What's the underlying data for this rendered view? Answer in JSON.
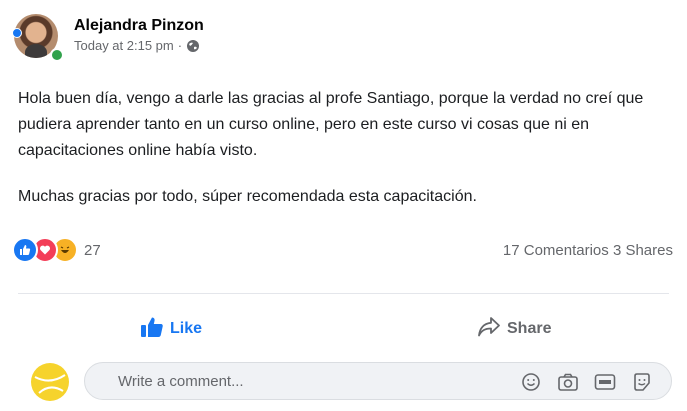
{
  "post": {
    "author": "Alejandra Pinzon",
    "timestamp": "Today at 2:15 pm",
    "separator": "·",
    "privacy_icon": "globe-icon",
    "paragraphs": [
      "Hola buen día, vengo a darle las gracias al profe Santiago, porque la verdad no creí que pudiera aprender tanto en un curso online, pero en este curso vi cosas que ni en capacitaciones online había visto.",
      "Muchas gracias por todo, súper recomendada esta capacitación."
    ]
  },
  "reactions": {
    "icons": [
      "like-reaction-icon",
      "love-reaction-icon",
      "haha-reaction-icon"
    ],
    "count": "27"
  },
  "stats": {
    "comments": "17 Comentarios",
    "shares": "3 Shares"
  },
  "actions": {
    "like_label": "Like",
    "share_label": "Share"
  },
  "comment": {
    "placeholder": "Write a comment..."
  },
  "colors": {
    "brand_blue": "#1877f2",
    "online_green": "#31a24c",
    "love_red": "#f33e58",
    "haha_yellow": "#f7b125",
    "muted_text": "#65676b"
  }
}
